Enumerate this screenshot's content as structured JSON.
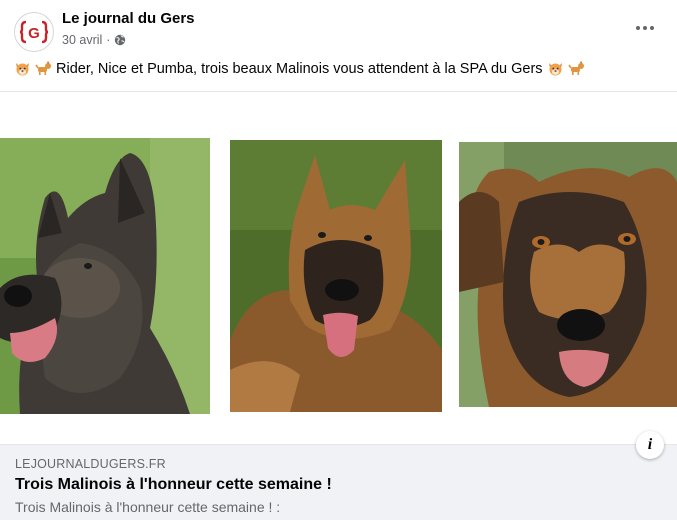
{
  "post": {
    "page_name": "Le journal du Gers",
    "date": "30 avril",
    "separator": "·",
    "privacy_icon": "globe-icon",
    "text": "Rider, Nice et Pumba, trois beaux Malinois vous attendent à la SPA du Gers",
    "emojis": [
      "dog-face-emoji",
      "dog-emoji"
    ],
    "logo_mark": "{G}",
    "brand_color": "#c4242a"
  },
  "media": {
    "photos": [
      {
        "name": "Rider",
        "description": "dog-photo"
      },
      {
        "name": "Nice",
        "description": "dog-photo"
      },
      {
        "name": "Pumba",
        "description": "dog-photo"
      }
    ]
  },
  "link": {
    "domain": "LEJOURNALDUGERS.FR",
    "title": "Trois Malinois à l'honneur cette semaine !",
    "description": "Trois Malinois à l'honneur cette semaine ! :",
    "info_label": "i"
  }
}
